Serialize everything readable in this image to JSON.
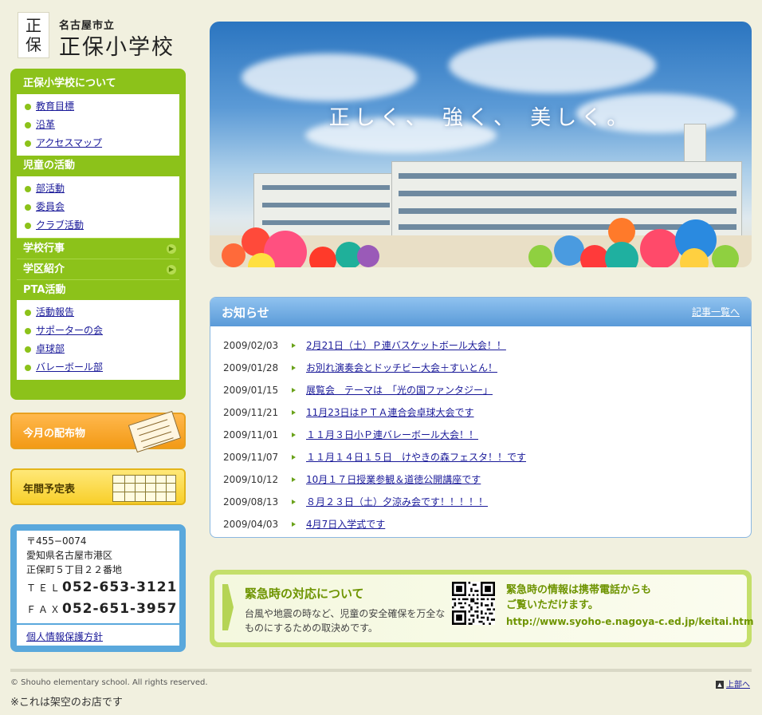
{
  "logo": {
    "mark_top": "正",
    "mark_bottom": "保",
    "city": "名古屋市立",
    "school": "正保小学校"
  },
  "nav": {
    "sections": [
      {
        "title": "正保小学校について",
        "items": [
          "教育目標",
          "沿革",
          "アクセスマップ"
        ]
      },
      {
        "title": "児童の活動",
        "items": [
          "部活動",
          "委員会",
          "クラブ活動"
        ]
      },
      {
        "title": "学校行事"
      },
      {
        "title": "学区紹介"
      },
      {
        "title": "PTA活動",
        "items": [
          "活動報告",
          "サポーターの会",
          "卓球部",
          "バレーボール部"
        ]
      }
    ]
  },
  "banners": {
    "monthly": "今月の配布物",
    "yearly": "年間予定表"
  },
  "address": {
    "postal": "〒455−0074",
    "line1": "愛知県名古屋市港区",
    "line2": "正保町５丁目２２番地",
    "tel_label": "ＴＥＬ",
    "tel": "052-653-3121",
    "fax_label": "ＦＡＸ",
    "fax": "052-651-3957",
    "privacy": "個人情報保護方針"
  },
  "hero": {
    "slogan": "正しく、 強く、  美しく。"
  },
  "news": {
    "title": "お知らせ",
    "more": "記事一覧へ",
    "items": [
      {
        "date": "2009/02/03",
        "text": "2月21日（土）Ｐ連バスケットボール大会！！"
      },
      {
        "date": "2009/01/28",
        "text": "お別れ演奏会とドッチビー大会＋すいとん！"
      },
      {
        "date": "2009/01/15",
        "text": "展覧会　テーマは　「光の国ファンタジー」"
      },
      {
        "date": "2009/11/21",
        "text": "11月23日はＰＴＡ連合会卓球大会です"
      },
      {
        "date": "2009/11/01",
        "text": "１１月３日小Ｐ連バレーボール大会！！"
      },
      {
        "date": "2009/11/07",
        "text": "１１月１４日１５日　けやきの森フェスタ！！です"
      },
      {
        "date": "2009/10/12",
        "text": "10月１７日授業参観＆道徳公開講座です"
      },
      {
        "date": "2009/08/13",
        "text": "８月２３日（土）夕涼み会です！！！！！"
      },
      {
        "date": "2009/04/03",
        "text": "4月7日入学式です"
      }
    ]
  },
  "emergency": {
    "title": "緊急時の対応について",
    "desc": "台風や地震の時など、児童の安全確保を万全なものにするための取決めです。",
    "mobile_line1": "緊急時の情報は携帯電話からも",
    "mobile_line2": "ご覧いただけます。",
    "url": "http://www.syoho-e.nagoya-c.ed.jp/keitai.htm"
  },
  "footer": {
    "copyright": "© Shouho elementary school. All rights reserved.",
    "pagetop": "上部へ",
    "note": "※これは架空のお店です"
  },
  "colors": {
    "nav_green": "#8cc21a",
    "news_blue": "#5a9ad8",
    "address_blue": "#5aa8dc",
    "emergency_green": "#6e9400",
    "background": "#f1f0df"
  }
}
